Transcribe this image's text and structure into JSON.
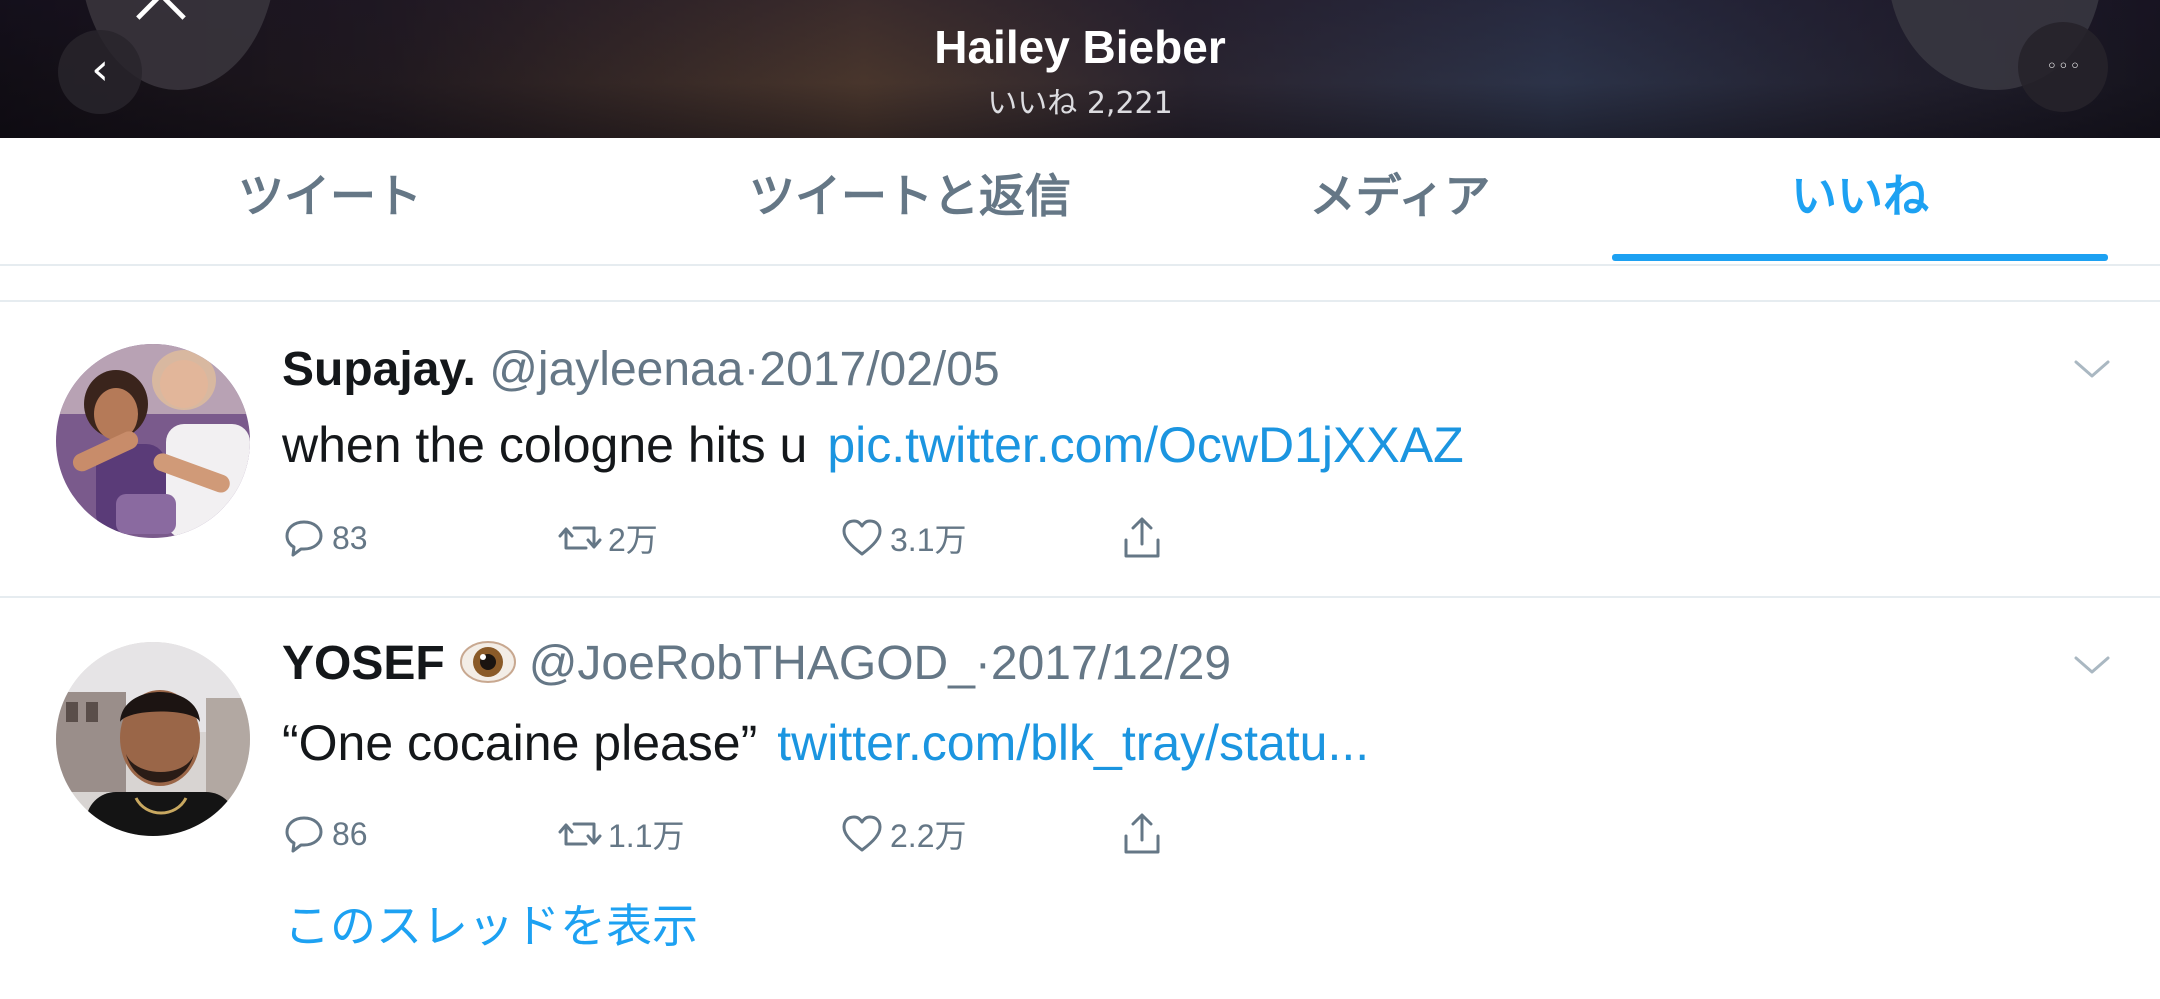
{
  "header": {
    "title": "Hailey Bieber",
    "likes_count": "いいね 2,221",
    "back_icon": "chevron-left-icon",
    "close_icon": "close-icon",
    "more_icon": "more-icon"
  },
  "tabs": [
    {
      "label": "ツイート",
      "active": false
    },
    {
      "label": "ツイートと返信",
      "active": false
    },
    {
      "label": "メディア",
      "active": false
    },
    {
      "label": "いいね",
      "active": true
    }
  ],
  "colors": {
    "accent": "#1da1f2",
    "link": "#1b95e0",
    "muted_text": "#657786",
    "primary_text": "#14171a",
    "divider": "#e6ecf0"
  },
  "tweets": [
    {
      "display_name": "Supajay.",
      "handle": "@jayleenaa",
      "separator": "·",
      "date": "2017/02/05",
      "text": "when the cologne hits u",
      "link": "pic.twitter.com/OcwD1jXXAZ",
      "replies": "83",
      "retweets": "2万",
      "likes": "3.1万"
    },
    {
      "display_name": "YOSEF",
      "name_emoji": "eye-icon",
      "handle": "@JoeRobTHAGOD_",
      "separator": "·",
      "date": "2017/12/29",
      "text": "“One cocaine please”",
      "link": "twitter.com/blk_tray/statu...",
      "replies": "86",
      "retweets": "1.1万",
      "likes": "2.2万",
      "show_thread": "このスレッドを表示"
    }
  ]
}
